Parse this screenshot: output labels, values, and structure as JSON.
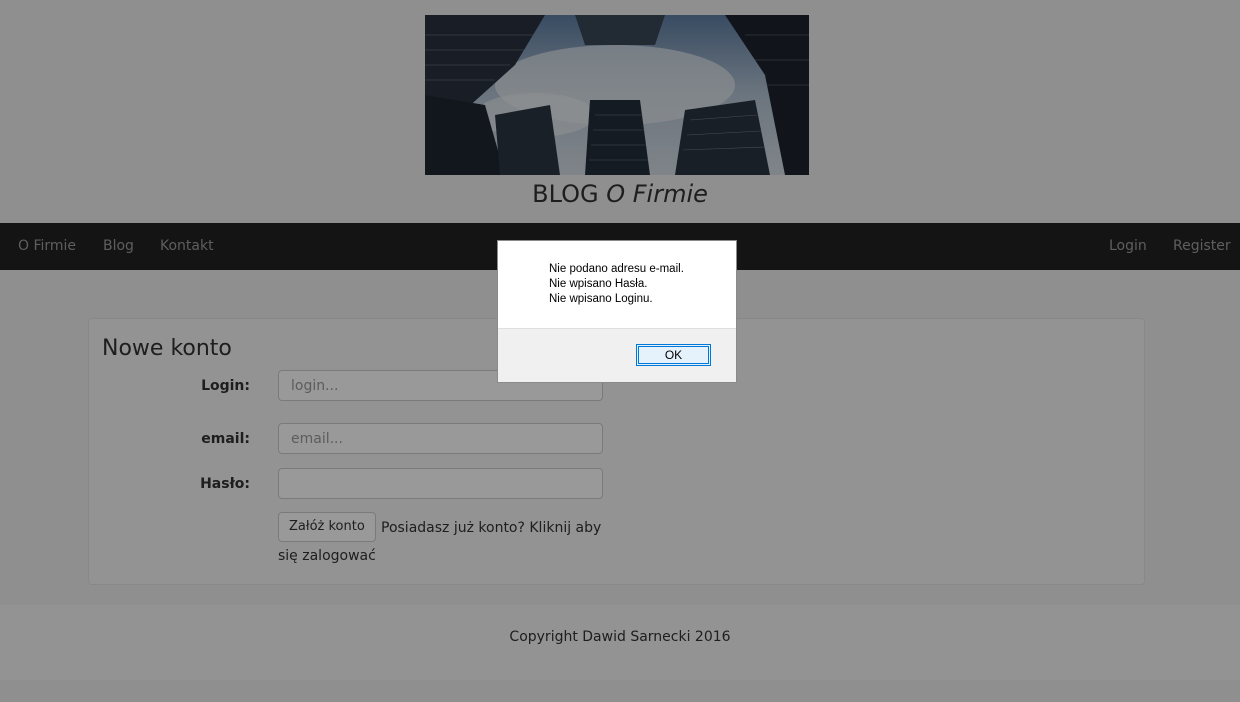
{
  "header": {
    "title_plain": "BLOG ",
    "title_italic": "O Firmie"
  },
  "navbar": {
    "left_items": [
      "O Firmie",
      "Blog",
      "Kontakt"
    ],
    "right_items": [
      "Login",
      "Register"
    ]
  },
  "form": {
    "heading": "Nowe konto",
    "login_label": "Login:",
    "login_placeholder": "login...",
    "email_label": "email:",
    "email_placeholder": "email...",
    "password_label": "Hasło:",
    "submit_label": "Załóż konto",
    "login_prompt": "Posiadasz już konto? Kliknij aby się zalogować"
  },
  "footer": {
    "copyright": "Copyright Dawid Sarnecki 2016"
  },
  "dialog": {
    "lines": [
      "Nie podano adresu e-mail.",
      "Nie wpisano Hasła.",
      "Nie wpisano Loginu."
    ],
    "ok_label": "OK"
  },
  "colors": {
    "navbar_bg": "#222222",
    "nav_text": "#9d9d9d",
    "dialog_button_border": "#0078d7"
  }
}
